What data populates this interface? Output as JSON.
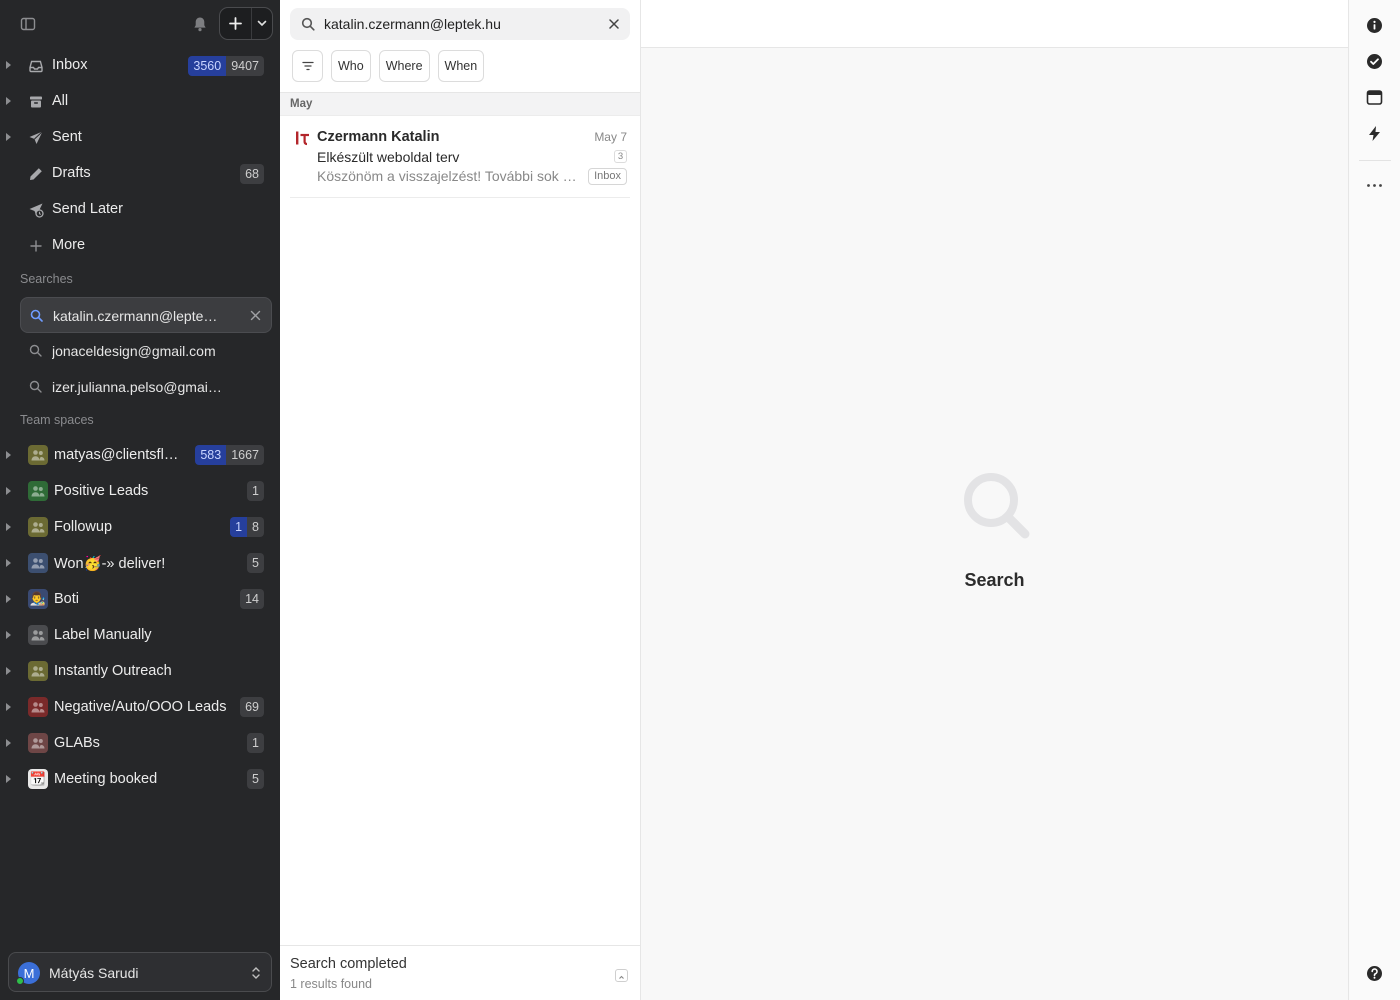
{
  "sidebar": {
    "folders": [
      {
        "label": "Inbox",
        "unread": "3560",
        "total": "9407",
        "icon": "inbox-icon",
        "expandable": true
      },
      {
        "label": "All",
        "unread": "",
        "total": "",
        "icon": "archive-icon",
        "expandable": true
      },
      {
        "label": "Sent",
        "unread": "",
        "total": "",
        "icon": "send-icon",
        "expandable": true
      },
      {
        "label": "Drafts",
        "unread": "",
        "total": "68",
        "icon": "pencil-icon",
        "expandable": false
      },
      {
        "label": "Send Later",
        "unread": "",
        "total": "",
        "icon": "send-later-icon",
        "expandable": false
      },
      {
        "label": "More",
        "unread": "",
        "total": "",
        "icon": "plus-icon",
        "expandable": false
      }
    ],
    "searches_title": "Searches",
    "searches": [
      {
        "label": "katalin.czermann@leptek.hu",
        "active": true
      },
      {
        "label": "jonaceldesign@gmail.com",
        "active": false
      },
      {
        "label": "izer.julianna.pelso@gmail.com",
        "active": false
      }
    ],
    "team_title": "Team spaces",
    "teams": [
      {
        "label": "matyas@clientsflow.com",
        "unread": "583",
        "total": "1667",
        "avatar_color": "#6b6a33",
        "avatar_glyph": "people"
      },
      {
        "label": "Positive Leads",
        "unread": "",
        "total": "1",
        "avatar_color": "#2f6b37",
        "avatar_glyph": "people"
      },
      {
        "label": "Followup",
        "unread": "1",
        "total": "8",
        "avatar_color": "#6b6a33",
        "avatar_glyph": "people"
      },
      {
        "label": "Won🥳-» deliver!",
        "unread": "",
        "total": "5",
        "avatar_color": "#3c4f70",
        "avatar_glyph": "people"
      },
      {
        "label": "Boti",
        "unread": "",
        "total": "14",
        "avatar_color": "#3a4a72",
        "avatar_glyph": "emoji",
        "emoji": "👨‍🎨"
      },
      {
        "label": "Label Manually",
        "unread": "",
        "total": "",
        "avatar_color": "#4a4b4e",
        "avatar_glyph": "people"
      },
      {
        "label": "Instantly Outreach",
        "unread": "",
        "total": "",
        "avatar_color": "#6b6a33",
        "avatar_glyph": "people"
      },
      {
        "label": "Negative/Auto/OOO Leads",
        "unread": "",
        "total": "69",
        "avatar_color": "#7a2a2a",
        "avatar_glyph": "people"
      },
      {
        "label": "GLABs",
        "unread": "",
        "total": "1",
        "avatar_color": "#6e4646",
        "avatar_glyph": "people"
      },
      {
        "label": "Meeting booked",
        "unread": "",
        "total": "5",
        "avatar_color": "#e8e8e8",
        "avatar_glyph": "emoji",
        "emoji": "📆"
      }
    ],
    "account": {
      "initial": "M",
      "name": "Mátyás Sarudi"
    }
  },
  "list": {
    "search_value": "katalin.czermann@leptek.hu",
    "filters": [
      "Who",
      "Where",
      "When"
    ],
    "group": "May",
    "messages": [
      {
        "sender": "Czermann Katalin",
        "date": "May 7",
        "subject": "Elkészült weboldal terv",
        "count": "3",
        "snippet": "Köszönöm a visszajelzést! További sok sikert kívánok!",
        "label": "Inbox"
      }
    ],
    "status_title": "Search completed",
    "status_sub": "1 results found"
  },
  "reading": {
    "empty_label": "Search"
  },
  "colors": {
    "sidebar_bg": "#262729",
    "badge_blue": "#263f9c",
    "brand_red": "#b3262b"
  }
}
